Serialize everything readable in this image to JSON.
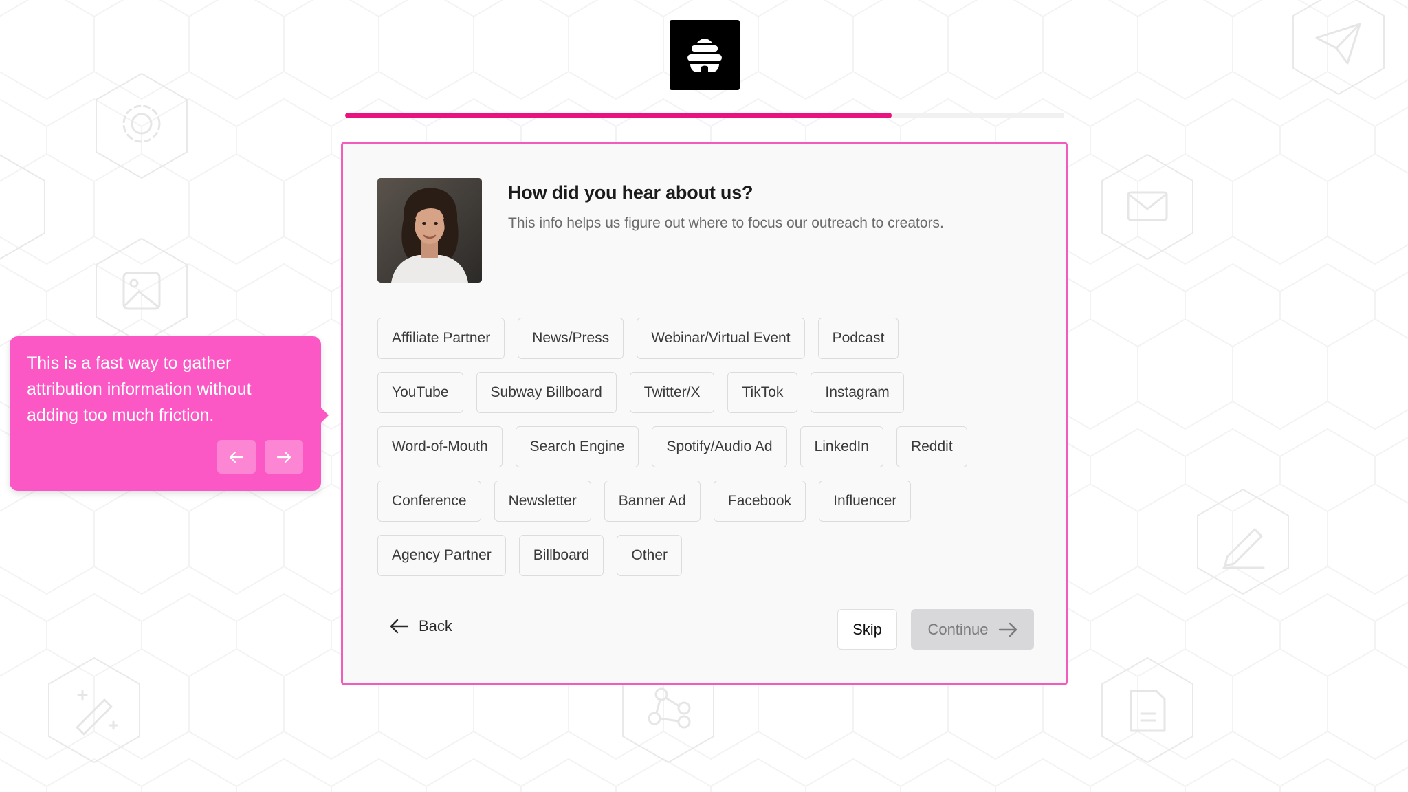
{
  "brand": {
    "accent": "#ea127e",
    "card_border": "#f25dbd",
    "tooltip_bg": "#fc58c5"
  },
  "logo": {
    "icon": "beehive-icon"
  },
  "progress": {
    "fraction": 0.76
  },
  "question": {
    "title": "How did you hear about us?",
    "subtitle": "This info helps us figure out where to focus our outreach to creators."
  },
  "options": [
    [
      "Affiliate Partner",
      "News/Press",
      "Webinar/Virtual Event",
      "Podcast"
    ],
    [
      "YouTube",
      "Subway Billboard",
      "Twitter/X",
      "TikTok",
      "Instagram"
    ],
    [
      "Word-of-Mouth",
      "Search Engine",
      "Spotify/Audio Ad",
      "LinkedIn",
      "Reddit"
    ],
    [
      "Conference",
      "Newsletter",
      "Banner Ad",
      "Facebook",
      "Influencer"
    ],
    [
      "Agency Partner",
      "Billboard",
      "Other"
    ]
  ],
  "footer": {
    "back_label": "Back",
    "skip_label": "Skip",
    "continue_label": "Continue"
  },
  "tooltip": {
    "text": "This is a fast way to gather attribution information without adding too much friction.",
    "prev_icon": "arrow-left-icon",
    "next_icon": "arrow-right-icon"
  }
}
